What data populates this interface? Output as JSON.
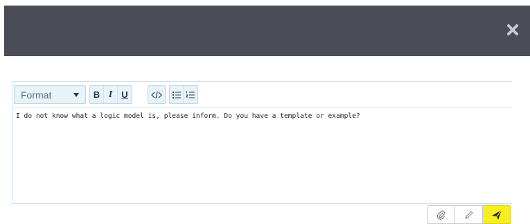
{
  "toolbar": {
    "format_label": "Format",
    "bold_label": "B",
    "italic_label": "I",
    "underline_label": "U"
  },
  "editor": {
    "content": "I do not know what a logic model is, please inform. Do you have a template or example?"
  },
  "icons": {
    "close": "close-icon",
    "code": "code-icon",
    "bullet_list": "bulleted-list-icon",
    "numbered_list": "numbered-list-icon",
    "attach": "paperclip-icon",
    "edit": "pencil-icon",
    "send": "send-icon"
  },
  "colors": {
    "header_bg": "#4a4d57",
    "send_bg": "#f6ee1f",
    "toolbar_btn_bg": "#e8f3f9"
  }
}
